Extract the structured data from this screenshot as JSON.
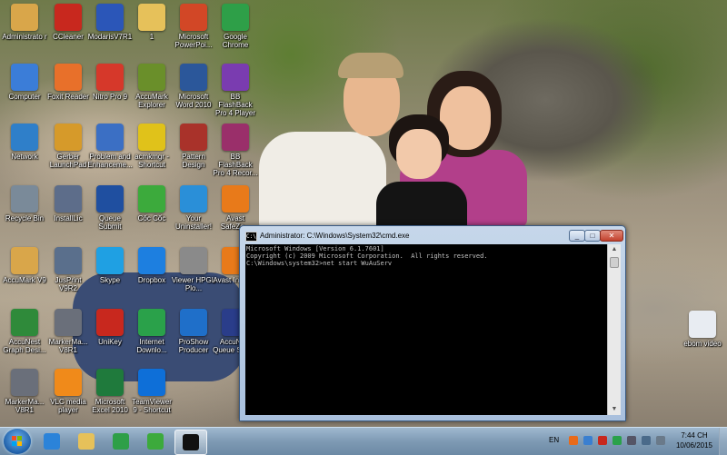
{
  "desktop_icons": [
    {
      "label": "Administrato r",
      "icon": "user-folder-icon",
      "color": "#d9a64a"
    },
    {
      "label": "CCleaner",
      "icon": "ccleaner-icon",
      "color": "#c8281e"
    },
    {
      "label": "ModarisV7R1",
      "icon": "modaris-icon",
      "color": "#2b56b8"
    },
    {
      "label": "1",
      "icon": "folder-icon",
      "color": "#e6c15a"
    },
    {
      "label": "Microsoft PowerPoi...",
      "icon": "powerpoint-icon",
      "color": "#d24726"
    },
    {
      "label": "Google Chrome",
      "icon": "chrome-icon",
      "color": "#2e9f48"
    },
    {
      "label": "Computer",
      "icon": "computer-icon",
      "color": "#3b7dd8"
    },
    {
      "label": "Foxit Reader",
      "icon": "foxit-reader-icon",
      "color": "#e8702a"
    },
    {
      "label": "Nitro Pro 9",
      "icon": "nitro-pro-icon",
      "color": "#d6382a"
    },
    {
      "label": "AccuMark Explorer",
      "icon": "accumark-explorer-icon",
      "color": "#6a8f2a"
    },
    {
      "label": "Microsoft Word 2010",
      "icon": "word-icon",
      "color": "#2b579a"
    },
    {
      "label": "BB FlashBack Pro 4 Player",
      "icon": "flashback-player-icon",
      "color": "#7a3cb0"
    },
    {
      "label": "Network",
      "icon": "network-icon",
      "color": "#2f7fc9"
    },
    {
      "label": "Gerber LaunchPad",
      "icon": "gerber-launchpad-icon",
      "color": "#d69a2a"
    },
    {
      "label": "Problem and Enhanceme...",
      "icon": "problem-report-icon",
      "color": "#3b6fc4"
    },
    {
      "label": "acmkmgr - Shortcut",
      "icon": "acmkmgr-icon",
      "color": "#e0c21a"
    },
    {
      "label": "Pattern Design",
      "icon": "pattern-design-icon",
      "color": "#a9322a"
    },
    {
      "label": "BB FlashBack Pro 4 Recor...",
      "icon": "flashback-recorder-icon",
      "color": "#9a2f6a"
    },
    {
      "label": "Recycle Bin",
      "icon": "recycle-bin-icon",
      "color": "#7a8a99"
    },
    {
      "label": "InstallLic",
      "icon": "installlic-icon",
      "color": "#5d6d8a"
    },
    {
      "label": "Queue Submit",
      "icon": "queue-submit-icon",
      "color": "#1f4fa0"
    },
    {
      "label": "Cốc Cốc",
      "icon": "coccoc-icon",
      "color": "#3caa3c"
    },
    {
      "label": "Your Uninstaller!",
      "icon": "uninstaller-icon",
      "color": "#2a8fd8"
    },
    {
      "label": "Avast SafeZo...",
      "icon": "avast-safezone-icon",
      "color": "#e87a1a"
    },
    {
      "label": "AccuMark V9",
      "icon": "accumark-v9-icon",
      "color": "#d9a64a"
    },
    {
      "label": "JusPrint V9R2",
      "icon": "jusprint-icon",
      "color": "#5a6f8c"
    },
    {
      "label": "Skype",
      "icon": "skype-icon",
      "color": "#1fa0e3"
    },
    {
      "label": "Dropbox",
      "icon": "dropbox-icon",
      "color": "#1d7fe0"
    },
    {
      "label": "Viewer HPGL Plo...",
      "icon": "hpgl-viewer-icon",
      "color": "#8a8a8a"
    },
    {
      "label": "Avast Intern...",
      "icon": "avast-icon",
      "color": "#e87a1a"
    },
    {
      "label": "AccuNest Graph Desi...",
      "icon": "accunest-graph-icon",
      "color": "#2f8a3a"
    },
    {
      "label": "MarkerMa... V8R1",
      "icon": "markermaker-icon",
      "color": "#6a6f7a"
    },
    {
      "label": "UniKey",
      "icon": "unikey-icon",
      "color": "#c8281e"
    },
    {
      "label": "Internet Downlo...",
      "icon": "idm-icon",
      "color": "#2aa14a"
    },
    {
      "label": "ProShow Producer",
      "icon": "proshow-icon",
      "color": "#1f6fc9"
    },
    {
      "label": "AccuNest Queue Server",
      "icon": "accunest-queue-icon",
      "color": "#2a3d8a"
    },
    {
      "label": "MarkerMa... V8R1",
      "icon": "markermaker-2-icon",
      "color": "#6a6f7a"
    },
    {
      "label": "VLC media player",
      "icon": "vlc-icon",
      "color": "#f08a1a"
    },
    {
      "label": "Microsoft Excel 2010",
      "icon": "excel-icon",
      "color": "#1f7a3c"
    },
    {
      "label": "TeamViewer 9 - Shortcut",
      "icon": "teamviewer-icon",
      "color": "#0e6fd8"
    },
    {
      "label": "ebom video",
      "icon": "text-file-icon",
      "color": "#e8ecf2"
    }
  ],
  "cmd_window": {
    "title": "Administrator: C:\\Windows\\System32\\cmd.exe",
    "icon_text": "C:\\",
    "min_label": "_",
    "max_label": "□",
    "close_label": "✕",
    "console_lines": [
      "Microsoft Windows [Version 6.1.7601]",
      "Copyright (c) 2009 Microsoft Corporation.  All rights reserved.",
      "",
      "C:\\Windows\\system32>net start WuAuServ"
    ]
  },
  "taskbar": {
    "items": [
      {
        "name": "internet-explorer",
        "color": "#2b83d9"
      },
      {
        "name": "windows-explorer",
        "color": "#e6c15a"
      },
      {
        "name": "google-chrome",
        "color": "#2e9f48"
      },
      {
        "name": "coccoc",
        "color": "#3caa3c"
      },
      {
        "name": "command-prompt",
        "color": "#111111"
      }
    ],
    "lang": "EN",
    "time": "7:44 CH",
    "date": "10/06/2015"
  }
}
